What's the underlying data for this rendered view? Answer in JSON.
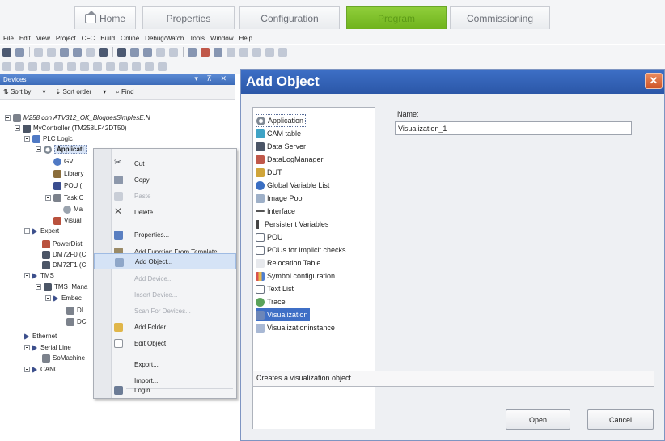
{
  "ribbon": {
    "tabs": [
      {
        "label": "Home",
        "icon": "home-icon"
      },
      {
        "label": "Properties"
      },
      {
        "label": "Configuration"
      },
      {
        "label": "Program",
        "active": true
      },
      {
        "label": "Commissioning"
      }
    ]
  },
  "menubar": {
    "items": [
      "File",
      "Edit",
      "View",
      "Project",
      "CFC",
      "Build",
      "Online",
      "Debug/Watch",
      "Tools",
      "Window",
      "Help"
    ]
  },
  "devices_pane": {
    "title": "Devices",
    "header_controls": "▾ ⊼ ✕",
    "toolbar": {
      "sort_by": "Sort by",
      "sort_order": "Sort order",
      "find": "Find"
    },
    "tree": {
      "project": "M258 con ATV312_OK_BloquesSimplesE.N",
      "controller": "MyController (TM258LF42DT50)",
      "plc_logic": "PLC Logic",
      "application": "Applicati",
      "gvl": "GVL",
      "library": "Library",
      "pou": "POU (",
      "task": "Task C",
      "task_child": "Ma",
      "visual": "Visual",
      "expert": "Expert",
      "power": "PowerDist",
      "dm72f0": "DM72F0 (C",
      "dm72f1": "DM72F1 (C",
      "tms": "TMS",
      "tms_manager": "TMS_Mana",
      "embedded": "Embec",
      "sub1": "DI",
      "sub2": "DC",
      "ethernet": "Ethernet",
      "serial": "Serial Line",
      "somachine": "SoMachine",
      "can0": "CAN0"
    }
  },
  "context_menu": {
    "items": [
      {
        "label": "Cut",
        "icon": "scissors-icon"
      },
      {
        "label": "Copy",
        "icon": "copy-icon"
      },
      {
        "label": "Paste",
        "icon": "paste-icon",
        "disabled": true
      },
      {
        "label": "Delete",
        "icon": "delete-icon"
      },
      {
        "label": "Properties...",
        "icon": "properties-icon"
      },
      {
        "label": "Add Function From Template",
        "icon": "template-icon"
      },
      {
        "label": "Add Object...",
        "icon": "add-object-icon",
        "highlighted": true
      },
      {
        "label": "Add Device...",
        "disabled": true
      },
      {
        "label": "Insert Device...",
        "disabled": true
      },
      {
        "label": "Scan For Devices...",
        "disabled": true
      },
      {
        "label": "Add Folder...",
        "icon": "folder-icon"
      },
      {
        "label": "Edit Object",
        "icon": "edit-object-icon"
      },
      {
        "label": "Export..."
      },
      {
        "label": "Import..."
      },
      {
        "label": "Login",
        "icon": "login-icon"
      }
    ]
  },
  "dialog": {
    "title": "Add Object",
    "close": "✕",
    "object_types": [
      "Application",
      "CAM table",
      "Data Server",
      "DataLogManager",
      "DUT",
      "Global Variable List",
      "Image Pool",
      "Interface",
      "Persistent Variables",
      "POU",
      "POUs for implicit checks",
      "Relocation Table",
      "Symbol configuration",
      "Text List",
      "Trace",
      "Visualization",
      "Visualizationinstance"
    ],
    "selected_type": "Visualization",
    "name_label": "Name:",
    "name_value": "Visualization_1",
    "description": "Creates a visualization object",
    "open_button": "Open",
    "cancel_button": "Cancel"
  },
  "colors": {
    "accent": "#3f6fc6",
    "program_tab": "#7ac02a",
    "dialog_title": "#2f5db0",
    "close_button": "#d9602e"
  }
}
